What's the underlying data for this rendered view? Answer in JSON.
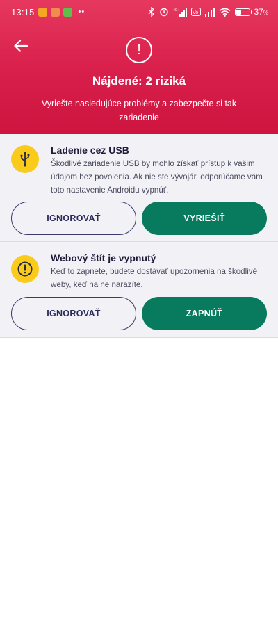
{
  "status_bar": {
    "time": "13:15",
    "network_label": "4G+",
    "volte_label": "Vo",
    "battery_percent": "37",
    "battery_level": 0.37
  },
  "header": {
    "title": "Nájdené: 2 riziká",
    "subtitle": "Vyriešte nasledujúce problémy a zabezpečte si tak zariadenie"
  },
  "issues": [
    {
      "title": "Ladenie cez USB",
      "description": "Škodlivé zariadenie USB by mohlo získať prístup k vašim údajom bez povolenia. Ak nie ste vývojár, odporúčame vám toto nastavenie Androidu vypnúť.",
      "icon": "usb-icon",
      "secondary_label": "IGNOROVAŤ",
      "primary_label": "VYRIEŠIŤ"
    },
    {
      "title": "Webový štít je vypnutý",
      "description": "Keď to zapnete, budete dostávať upozornenia na škodlivé weby, keď na ne narazíte.",
      "icon": "alert-icon",
      "secondary_label": "IGNOROVAŤ",
      "primary_label": "ZAPNÚŤ"
    }
  ],
  "colors": {
    "header": "#d81e4a",
    "accent_green": "#087a5d",
    "icon_yellow": "#fbcb1c",
    "outline": "#3b3a6e"
  }
}
